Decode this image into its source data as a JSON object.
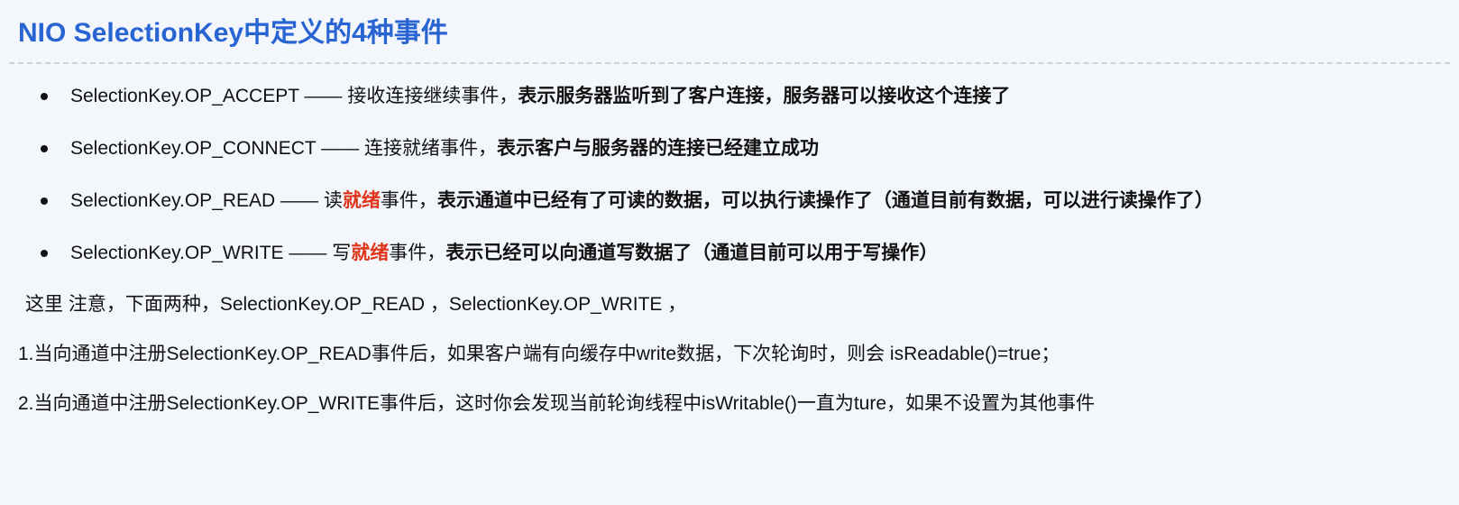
{
  "heading": "NIO SelectionKey中定义的4种事件",
  "events": [
    {
      "key": "SelectionKey.OP_ACCEPT —— ",
      "pre": "接收连接继续事件，",
      "hl": "",
      "post": "",
      "desc": "表示服务器监听到了客户连接，服务器可以接收这个连接了"
    },
    {
      "key": "SelectionKey.OP_CONNECT —— ",
      "pre": "连接就绪事件，",
      "hl": "",
      "post": "",
      "desc": "表示客户与服务器的连接已经建立成功"
    },
    {
      "key": "SelectionKey.OP_READ —— ",
      "pre": "读",
      "hl": "就绪",
      "post": "事件，",
      "desc": "表示通道中已经有了可读的数据，可以执行读操作了（通道目前有数据，可以进行读操作了）"
    },
    {
      "key": "SelectionKey.OP_WRITE —— ",
      "pre": "写",
      "hl": "就绪",
      "post": "事件，",
      "desc": "表示已经可以向通道写数据了（通道目前可以用于写操作）"
    }
  ],
  "note": "这里 注意，下面两种，SelectionKey.OP_READ ，SelectionKey.OP_WRITE ，",
  "point1": "1.当向通道中注册SelectionKey.OP_READ事件后，如果客户端有向缓存中write数据，下次轮询时，则会 isReadable()=true；",
  "point2": "2.当向通道中注册SelectionKey.OP_WRITE事件后，这时你会发现当前轮询线程中isWritable()一直为ture，如果不设置为其他事件"
}
